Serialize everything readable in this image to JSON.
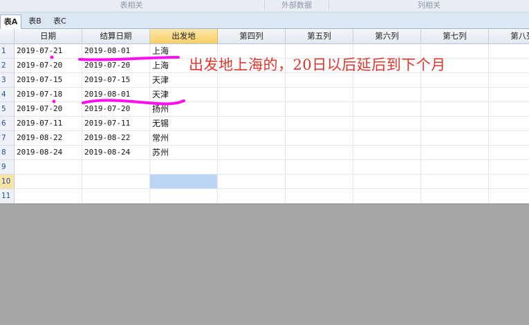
{
  "ribbon": {
    "groups": [
      "表相关",
      "外部数据",
      "列相关"
    ]
  },
  "sheet_tabs": [
    "表A",
    "表B",
    "表C"
  ],
  "columns": [
    "日期",
    "结算日期",
    "出发地",
    "第四列",
    "第五列",
    "第六列",
    "第七列",
    "第八列"
  ],
  "rows": [
    {
      "num": "1",
      "cells": [
        "2019-07-21",
        "2019-08-01",
        "上海"
      ]
    },
    {
      "num": "2",
      "cells": [
        "2019-07-20",
        "2019-07-20",
        "上海"
      ]
    },
    {
      "num": "3",
      "cells": [
        "2019-07-15",
        "2019-07-15",
        "天津"
      ]
    },
    {
      "num": "4",
      "cells": [
        "2019-07-18",
        "2019-08-01",
        "天津"
      ]
    },
    {
      "num": "5",
      "cells": [
        "2019-07-20",
        "2019-07-20",
        "扬州"
      ]
    },
    {
      "num": "6",
      "cells": [
        "2019-07-11",
        "2019-07-11",
        "无锡"
      ]
    },
    {
      "num": "7",
      "cells": [
        "2019-08-22",
        "2019-08-22",
        "常州"
      ]
    },
    {
      "num": "8",
      "cells": [
        "2019-08-24",
        "2019-08-24",
        "苏州"
      ]
    },
    {
      "num": "9",
      "cells": [
        "",
        "",
        ""
      ]
    },
    {
      "num": "10",
      "cells": [
        "",
        "",
        ""
      ]
    },
    {
      "num": "11",
      "cells": [
        "",
        "",
        ""
      ]
    }
  ],
  "annotation": "出发地上海的，20日以后延后到下个月",
  "colors": {
    "mark": "#ff10ef",
    "annotation_text": "#e5352b",
    "selection": "#bcd5f4",
    "header_selected": "#f7cf68"
  }
}
